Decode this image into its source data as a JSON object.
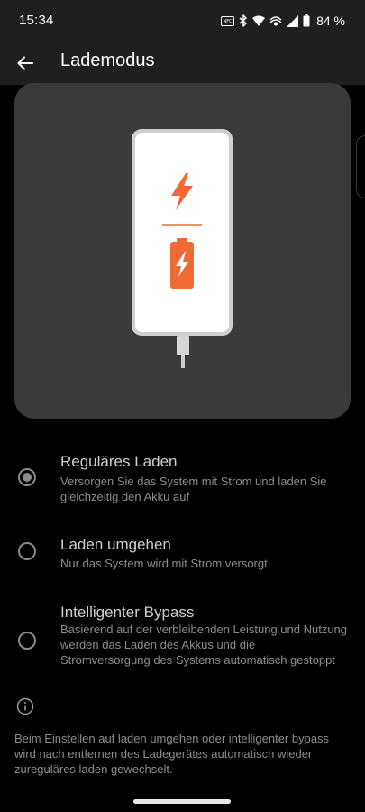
{
  "status_bar": {
    "time": "15:34",
    "nfc_label": "NFC",
    "battery_percent": "84 %",
    "icons": [
      "nfc-icon",
      "bluetooth-icon",
      "wifi-icon",
      "eye-comfort-icon",
      "signal-icon",
      "battery-icon"
    ]
  },
  "header": {
    "back_icon": "arrow-left-icon",
    "title": "Lademodus"
  },
  "illustration": {
    "icons": [
      "phone-icon",
      "lightning-bolt-icon",
      "battery-charging-icon",
      "cable-icon"
    ],
    "accent_color": "#f06a35",
    "card_color": "#3a3a3a"
  },
  "options": [
    {
      "title": "Reguläres Laden",
      "description": "Versorgen Sie das System mit Strom und laden Sie gleichzeitig den Akku auf",
      "selected": true
    },
    {
      "title": "Laden umgehen",
      "description": "Nur das System wird mit Strom versorgt",
      "selected": false
    },
    {
      "title": "Intelligenter Bypass",
      "description": "Basierend auf der verbleibenden Leistung und Nutzung werden das Laden des Akkus und die Stromversorgung des Systems automatisch gestoppt",
      "selected": false
    }
  ],
  "info": {
    "icon": "info-icon",
    "note": "Beim Einstellen auf laden umgehen oder intelligenter bypass wird nach entfernen des Ladegerätes automatisch wieder zureguläres laden gewechselt."
  }
}
